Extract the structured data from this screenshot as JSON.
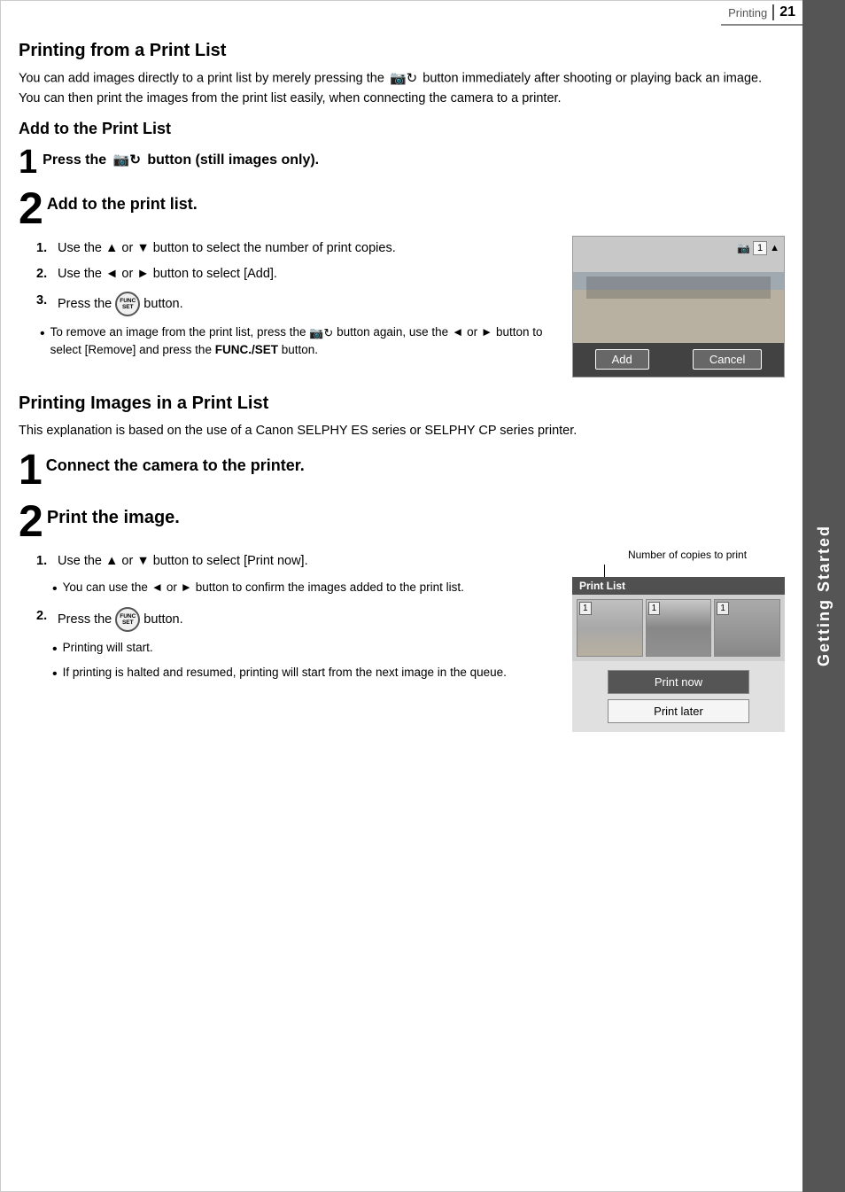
{
  "header": {
    "section_label": "Printing",
    "page_number": "21"
  },
  "sidebar": {
    "tab_label": "Getting Started"
  },
  "section1": {
    "title": "Printing from a Print List",
    "intro": "You can add images directly to a print list by merely pressing the",
    "intro2": "button immediately after shooting or playing back an image.",
    "intro3": "You can then print the images from the print list easily, when connecting the camera to a printer."
  },
  "subsection1": {
    "title": "Add to the Print List"
  },
  "step1": {
    "number": "1",
    "text": "Press the",
    "text2": "button (still images only)."
  },
  "step2": {
    "number": "2",
    "text": "Add to the print list.",
    "substep1_num": "1.",
    "substep1_text": "Use the ▲ or ▼ button to select the number of print copies.",
    "substep2_num": "2.",
    "substep2_text": "Use the ◄ or ► button to select [Add].",
    "substep3_num": "3.",
    "substep3_text": "Press the",
    "substep3_text2": "button.",
    "bullet1": "To remove an image from the print list, press the",
    "bullet1b": "button again, use the ◄ or ► button to select [Remove] and press the",
    "bullet1c": "FUNC./SET",
    "bullet1d": "button.",
    "preview_btn_add": "Add",
    "preview_btn_cancel": "Cancel"
  },
  "section2": {
    "title": "Printing Images in a Print List",
    "intro": "This explanation is based on the use of a Canon SELPHY ES series or SELPHY CP series printer."
  },
  "print_step1": {
    "number": "1",
    "text": "Connect the camera to the printer."
  },
  "print_step2": {
    "number": "2",
    "text": "Print the image.",
    "substep1_num": "1.",
    "substep1_text": "Use the ▲ or ▼ button to select [Print now].",
    "bullet1": "You can use the ◄ or ► button to confirm the images added to the print list.",
    "substep2_num": "2.",
    "substep2_text": "Press the",
    "substep2_text2": "button.",
    "bullet2": "Printing will start.",
    "bullet3": "If printing is halted and resumed, printing will start from the next image in the queue.",
    "print_list_header": "Print List",
    "number_of_copies_label": "Number of copies to print",
    "menu_print_now": "Print now",
    "menu_print_later": "Print later"
  }
}
